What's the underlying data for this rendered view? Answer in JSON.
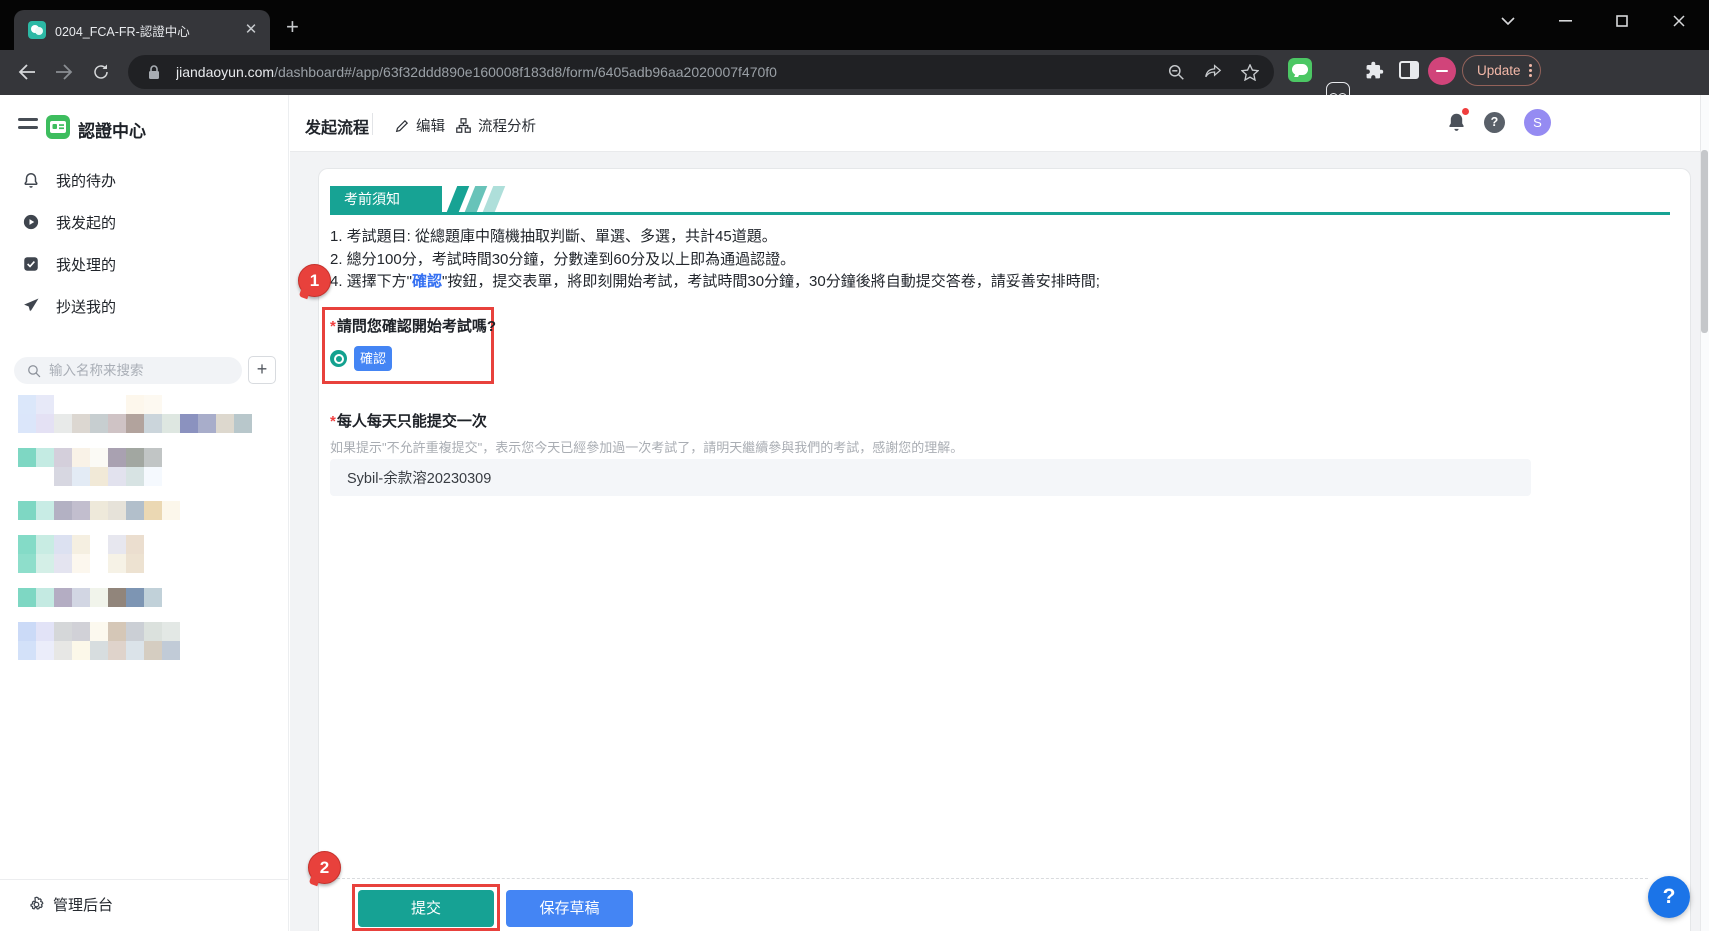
{
  "browser": {
    "tab_title": "0204_FCA-FR-認證中心",
    "new_tab": "+",
    "url_domain": "jiandaoyun.com",
    "url_path": "/dashboard#/app/63f32ddd890e160008f183d8/form/6405adb96aa2020007f470f0",
    "update_label": "Update"
  },
  "sidebar": {
    "app_title": "認證中心",
    "menu": {
      "todo": "我的待办",
      "initiated": "我发起的",
      "processed": "我处理的",
      "cc": "抄送我的"
    },
    "search_placeholder": "输入名称来搜索",
    "add_label": "+",
    "admin_label": "管理后台",
    "redacted_rows": [
      {
        "lines": [
          {
            "offset": 0,
            "cells": [
              "#dbe7fa",
              "#e7e9f8",
              null,
              null,
              null,
              null,
              "#fdf7ec",
              "#fdf9f1"
            ]
          },
          {
            "offset": 0,
            "cells": [
              "#dbe6fa",
              "#e4e1f4",
              "#e8eae9",
              "#dcd7d1",
              "#c7ced0",
              "#cfc3c5",
              "#b2a39d",
              "#cbd5db",
              "#dee7e1",
              "#8b92bf",
              "#a8adca",
              "#ddd8ce",
              "#b8c7cb"
            ]
          }
        ]
      },
      {
        "lines": [
          {
            "offset": 0,
            "cells": [
              "#7ed7c3",
              "#c4ebe3",
              "#d4cfdb",
              "#f9f2e7",
              "#fbfaf5",
              "#a9a1b1",
              "#a2a7a1",
              "#c1c5c5"
            ]
          },
          {
            "offset": 36,
            "cells": [
              "#d7d7e1",
              "#e3ebf5",
              "#f1e9d7",
              "#e2e2ee",
              "#d7e3e3",
              "#f5f9fe"
            ]
          }
        ]
      },
      {
        "lines": [
          {
            "offset": 0,
            "cells": [
              "#7ed7c3",
              "#c8ece5",
              "#b3b1c3",
              "#c2bece",
              "#eee9da",
              "#e6e2d9",
              "#b2bfcb",
              "#ebd8b3",
              "#fcf7eb"
            ]
          }
        ]
      },
      {
        "lines": [
          {
            "offset": 0,
            "cells": [
              "#84dbc7",
              "#c8ece3",
              "#dce1f1",
              "#f5efe1",
              null,
              "#e7e7ef",
              "#ebdecf"
            ]
          },
          {
            "offset": 0,
            "cells": [
              "#8edecb",
              "#d4efe7",
              "#e4e4f0",
              "#fcf7ee",
              null,
              "#f6f2e6",
              "#ede2d1"
            ]
          }
        ]
      },
      {
        "lines": [
          {
            "offset": 0,
            "cells": [
              "#7ed7c3",
              "#c4eae2",
              "#b4adc3",
              "#d2d6e3",
              "#f1f4eb",
              "#91857b",
              "#7d95b3",
              "#c1d1d9"
            ]
          }
        ]
      },
      {
        "lines": [
          {
            "offset": 0,
            "cells": [
              "#cbdaf7",
              "#e2e3f7",
              "#d5d7d9",
              "#d1d1d7",
              "#fcf9ef",
              "#d5c7b7",
              "#cbcfd5",
              "#dbe1dd",
              "#e3e8e5"
            ]
          },
          {
            "offset": 0,
            "cells": [
              "#d3e1f9",
              "#ebedfa",
              "#e7e7e5",
              "#fcf8e9",
              "#d7dddf",
              "#dfd3cb",
              "#dbe3e9",
              "#d5cdc1",
              "#c1cbd7"
            ]
          }
        ]
      }
    ]
  },
  "header": {
    "title": "发起流程",
    "edit_label": "编辑",
    "analysis_label": "流程分析",
    "help_mark": "?",
    "avatar_text": "S"
  },
  "form": {
    "notice_title": "考前須知",
    "line1": "1. 考試題目: 從總題庫中隨機抽取判斷、單選、多選，共計45道題。",
    "line2": "2. 總分100分，考試時間30分鐘，分數達到60分及以上即為通過認證。",
    "line4_pre": "4. 選擇下方\"",
    "line4_link": "確認",
    "line4_post": "\"按鈕，提交表單，將即刻開始考試，考試時間30分鐘，30分鐘後將自動提交答卷，請妥善安排時間;",
    "required_mark": "*",
    "q1_label": "請問您確認開始考試嗎?",
    "q1_option": "確認",
    "q2_label": "每人每天只能提交一次",
    "q2_help": "如果提示\"不允許重複提交\"，表示您今天已經參加過一次考試了，請明天繼續參與我們的考試，感謝您的理解。",
    "q2_value": "Sybil-余款溶20230309",
    "submit_label": "提交",
    "save_draft_label": "保存草稿",
    "help_fab": "?"
  },
  "annotations": {
    "step1": "1",
    "step2": "2"
  },
  "colors": {
    "teal_accent": "#17a394",
    "blue_accent": "#4485f4",
    "annotation_red": "#e8413c",
    "app_green": "#3dbd5e",
    "avatar_purple": "#958bf2",
    "browser_avatar_pink": "#d1447a",
    "fab_blue": "#1b74e8"
  }
}
